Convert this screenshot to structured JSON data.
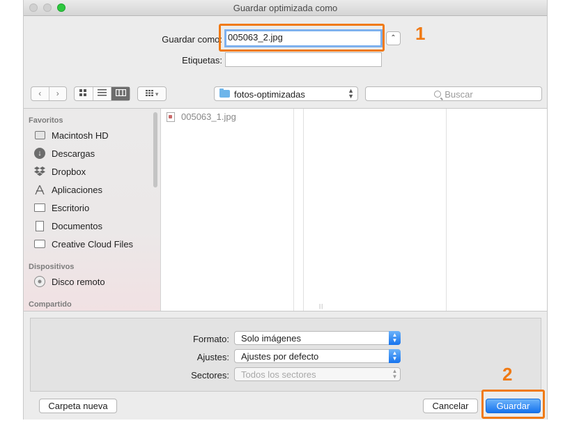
{
  "window": {
    "title": "Guardar optimizada como"
  },
  "save": {
    "label": "Guardar como:",
    "filename": "005063_2.jpg",
    "tags_label": "Etiquetas:",
    "tags_value": "",
    "expand_glyph": "⌃"
  },
  "toolbar": {
    "back_glyph": "‹",
    "forward_glyph": "›",
    "view_icons": [
      "icon-view-icon",
      "list-view-icon",
      "column-view-icon"
    ],
    "arrange_glyph": "▾",
    "location": "fotos-optimizadas",
    "search_placeholder": "Buscar"
  },
  "sidebar": {
    "favorites_title": "Favoritos",
    "favorites": [
      {
        "label": "Macintosh HD",
        "icon": "hard-drive-icon"
      },
      {
        "label": "Descargas",
        "icon": "downloads-icon"
      },
      {
        "label": "Dropbox",
        "icon": "dropbox-icon"
      },
      {
        "label": "Aplicaciones",
        "icon": "applications-icon"
      },
      {
        "label": "Escritorio",
        "icon": "desktop-icon"
      },
      {
        "label": "Documentos",
        "icon": "documents-icon"
      },
      {
        "label": "Creative Cloud Files",
        "icon": "folder-icon"
      }
    ],
    "devices_title": "Dispositivos",
    "devices": [
      {
        "label": "Disco remoto",
        "icon": "disc-icon"
      }
    ],
    "shared_title": "Compartido"
  },
  "files": [
    {
      "name": "005063_1.jpg"
    }
  ],
  "options": {
    "format_label": "Formato:",
    "format_value": "Solo imágenes",
    "settings_label": "Ajustes:",
    "settings_value": "Ajustes por defecto",
    "slices_label": "Sectores:",
    "slices_value": "Todos los sectores"
  },
  "buttons": {
    "new_folder": "Carpeta nueva",
    "cancel": "Cancelar",
    "save": "Guardar"
  },
  "annotations": {
    "one": "1",
    "two": "2",
    "color": "#f07a14"
  },
  "colors": {
    "accent": "#1673ee",
    "callout": "#f07a14",
    "traffic_green": "#2ec840"
  }
}
